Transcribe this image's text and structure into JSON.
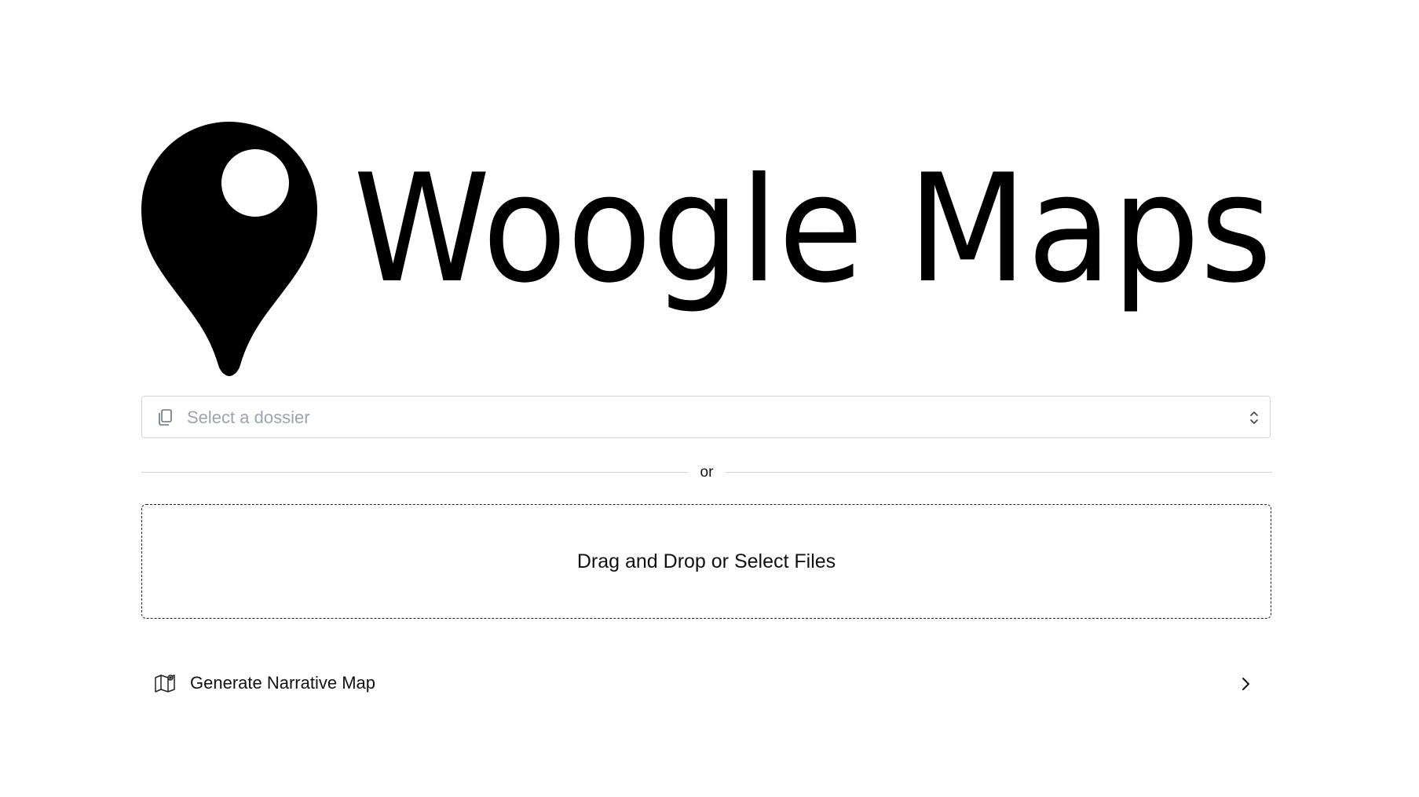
{
  "brand": {
    "name": "Woogle Maps"
  },
  "dossier_select": {
    "placeholder": "Select a dossier",
    "leading_icon": "copy-icon",
    "trailing_icon": "chevron-up-down-icon"
  },
  "divider": {
    "label": "or"
  },
  "dropzone": {
    "label": "Drag and Drop or Select Files"
  },
  "generate": {
    "label": "Generate Narrative Map",
    "leading_icon": "map-icon",
    "trailing_icon": "chevron-right-icon"
  },
  "colors": {
    "text": "#111111",
    "placeholder": "#9ca3af",
    "border": "#d4d4d8",
    "logo": "#000000",
    "background": "#ffffff"
  }
}
